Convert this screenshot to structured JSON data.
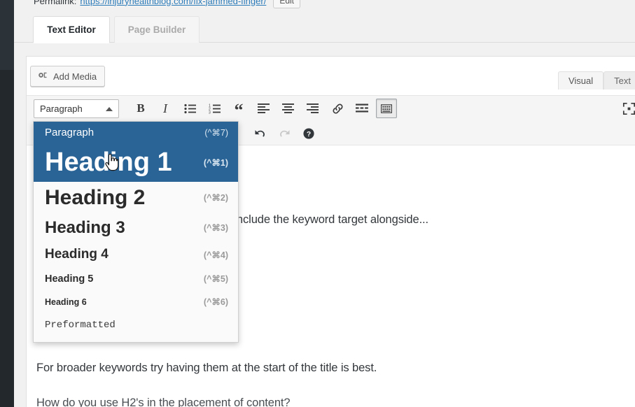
{
  "permalink": {
    "label": "Permalink:",
    "url": "https://injuryhealthblog.com/fix-jammed-finger/",
    "edit_button": "Edit"
  },
  "tabs": [
    {
      "label": "Text Editor",
      "active": true
    },
    {
      "label": "Page Builder",
      "active": false
    }
  ],
  "toolbar": {
    "add_media_label": "Add Media",
    "format_select_value": "Paragraph",
    "buttons_row1": [
      {
        "name": "bold-icon",
        "title": "B"
      },
      {
        "name": "italic-icon",
        "title": "I"
      },
      {
        "name": "bulleted-list-icon",
        "title": "Bulleted list"
      },
      {
        "name": "numbered-list-icon",
        "title": "Numbered list"
      },
      {
        "name": "blockquote-icon",
        "title": "Blockquote"
      },
      {
        "name": "align-left-icon",
        "title": "Align left"
      },
      {
        "name": "align-center-icon",
        "title": "Align center"
      },
      {
        "name": "align-right-icon",
        "title": "Align right"
      },
      {
        "name": "link-icon",
        "title": "Insert/edit link"
      },
      {
        "name": "read-more-icon",
        "title": "Insert Read More tag"
      },
      {
        "name": "toolbar-toggle-icon",
        "title": "Toolbar Toggle"
      }
    ],
    "buttons_row2": [
      {
        "name": "undo-icon",
        "title": "Undo"
      },
      {
        "name": "redo-icon",
        "title": "Redo"
      },
      {
        "name": "help-icon",
        "title": "Keyboard Shortcuts"
      }
    ],
    "fullscreen_icon": "distraction-free-writing-icon"
  },
  "editor_modes": [
    {
      "label": "Visual",
      "active": true
    },
    {
      "label": "Text",
      "active": false
    }
  ],
  "format_menu": {
    "open": true,
    "items": [
      {
        "label": "Paragraph",
        "shortcut": "(^⌘7)",
        "selected": true,
        "style": "it-para"
      },
      {
        "label": "Heading 1",
        "shortcut": "(^⌘1)",
        "selected": true,
        "style": "it-h1"
      },
      {
        "label": "Heading 2",
        "shortcut": "(^⌘2)",
        "selected": false,
        "style": "it-h2"
      },
      {
        "label": "Heading 3",
        "shortcut": "(^⌘3)",
        "selected": false,
        "style": "it-h3"
      },
      {
        "label": "Heading 4",
        "shortcut": "(^⌘4)",
        "selected": false,
        "style": "it-h4"
      },
      {
        "label": "Heading 5",
        "shortcut": "(^⌘5)",
        "selected": false,
        "style": "it-h5"
      },
      {
        "label": "Heading 6",
        "shortcut": "(^⌘6)",
        "selected": false,
        "style": "it-h6"
      },
      {
        "label": "Preformatted",
        "shortcut": "",
        "selected": false,
        "style": "it-pre"
      }
    ]
  },
  "content": {
    "paragraph_1": "Try to make it as natural as possible to include the keyword target alongside...",
    "paragraph_2": "For broader keywords try having them at the start of the title is best.",
    "paragraph_3": "How do you use H2's in the placement of content?"
  },
  "colors": {
    "menu_highlight": "#2a6496",
    "link": "#2b7bb9",
    "admin_rail": "#23282d",
    "page_bg": "#f1f1f1",
    "toolbar_bg": "#f5f5f5"
  }
}
